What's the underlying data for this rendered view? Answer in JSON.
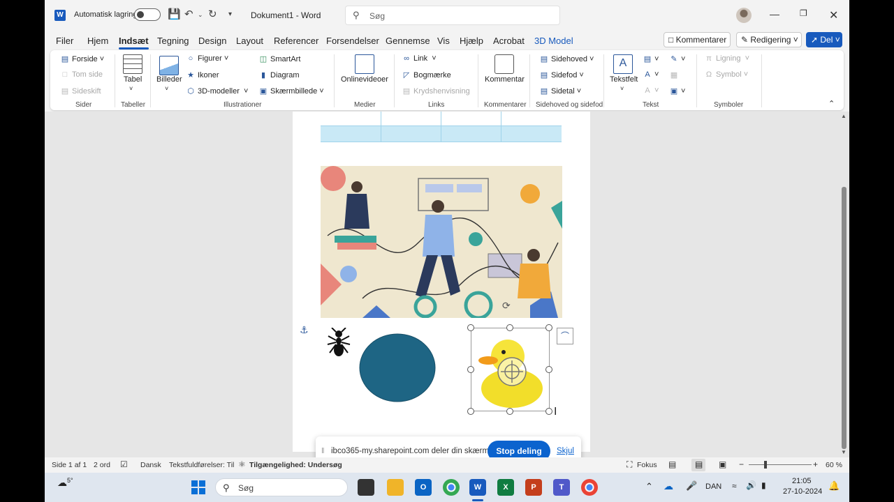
{
  "titlebar": {
    "autosave_label": "Automatisk lagring",
    "doc_title": "Dokument1  -  Word",
    "search_placeholder": "Søg"
  },
  "tabs": [
    "Filer",
    "Hjem",
    "Indsæt",
    "Tegning",
    "Design",
    "Layout",
    "Referencer",
    "Forsendelser",
    "Gennemse",
    "Vis",
    "Hjælp",
    "Acrobat",
    "3D Model"
  ],
  "active_tab": "Indsæt",
  "header_buttons": {
    "comments": "Kommentarer",
    "editing": "Redigering",
    "share": "Del"
  },
  "ribbon": {
    "sider": {
      "group": "Sider",
      "forside": "Forside",
      "tom_side": "Tom side",
      "sideskift": "Sideskift"
    },
    "tabeller": {
      "group": "Tabeller",
      "tabel": "Tabel"
    },
    "illustrationer": {
      "group": "Illustrationer",
      "billeder": "Billeder",
      "figurer": "Figurer",
      "ikoner": "Ikoner",
      "modeller": "3D-modeller",
      "smartart": "SmartArt",
      "diagram": "Diagram",
      "skaermbillede": "Skærmbillede"
    },
    "medier": {
      "group": "Medier",
      "onlinevideoer": "Onlinevideoer"
    },
    "links": {
      "group": "Links",
      "link": "Link",
      "bogmaerke": "Bogmærke",
      "krydshenvisning": "Krydshenvisning"
    },
    "kommentarer": {
      "group": "Kommentarer",
      "kommentar": "Kommentar"
    },
    "sidehoved": {
      "group": "Sidehoved og sidefod",
      "sidehoved": "Sidehoved",
      "sidefod": "Sidefod",
      "sidetal": "Sidetal"
    },
    "tekst": {
      "group": "Tekst",
      "tekstfelt": "Tekstfelt"
    },
    "symboler": {
      "group": "Symboler",
      "ligning": "Ligning",
      "symbol": "Symbol"
    }
  },
  "sharebar": {
    "message": "ibco365-my.sharepoint.com deler din skærm.",
    "stop": "Stop deling",
    "hide": "Skjul"
  },
  "statusbar": {
    "page": "Side 1 af 1",
    "words": "2 ord",
    "language": "Dansk",
    "predictions": "Tekstfuldførelser: Til",
    "accessibility": "Tilgængelighed: Undersøg",
    "focus": "Fokus",
    "zoom": "60 %"
  },
  "taskbar": {
    "weather": "5°",
    "search": "Søg",
    "lang": "DAN",
    "time": "21:05",
    "date": "27-10-2024"
  },
  "colors": {
    "word_blue": "#185abd",
    "share_blue": "#0b63ce",
    "ellipse": "#1e6584",
    "table_fill": "#c9e9f6"
  }
}
